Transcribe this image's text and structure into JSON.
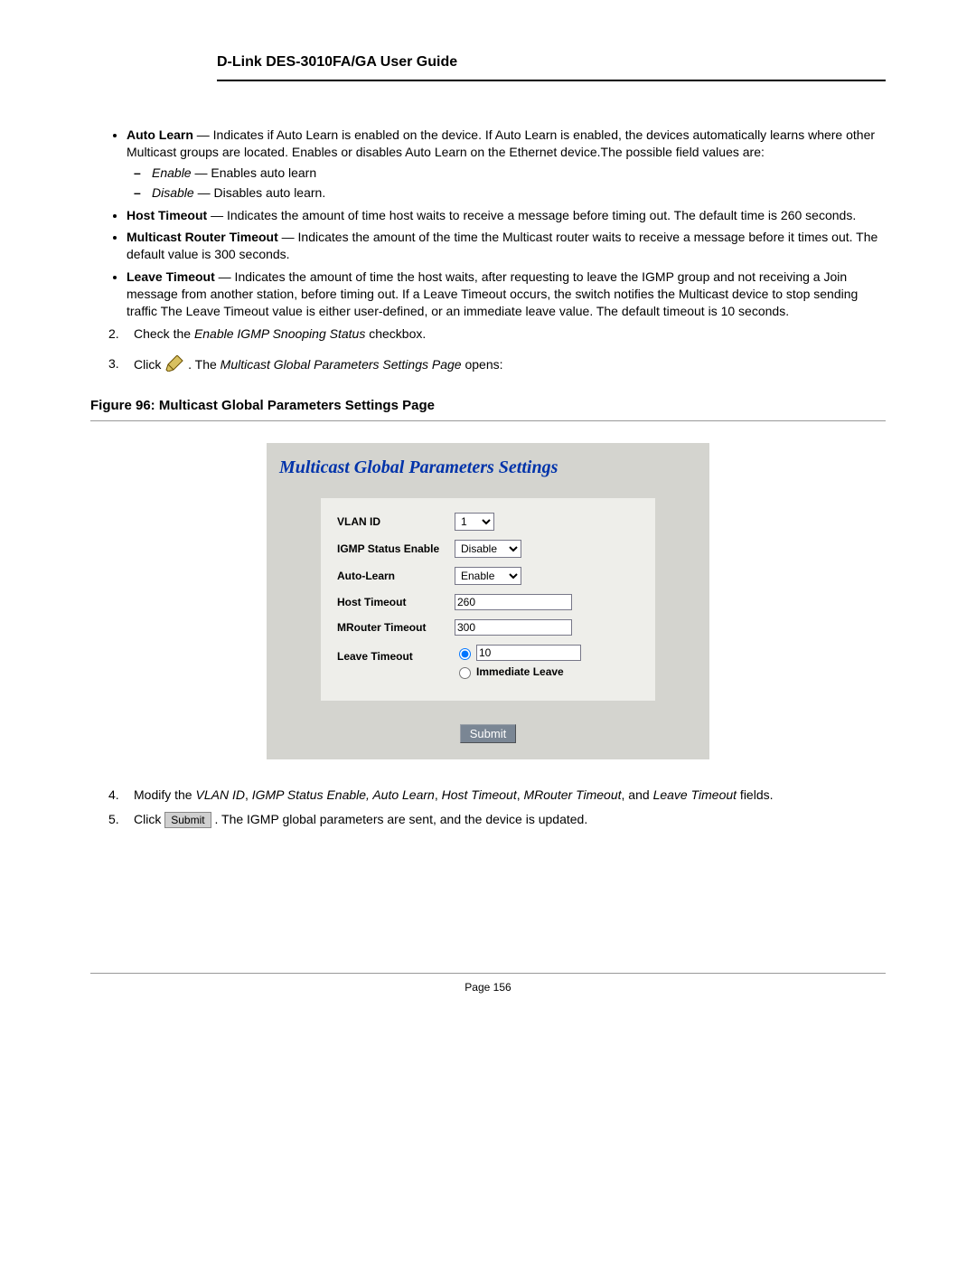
{
  "header": "D-Link DES-3010FA/GA User Guide",
  "bullets": {
    "autoLearn": {
      "term": "Auto Learn",
      "desc": " — Indicates if Auto Learn is enabled on the device. If Auto Learn is enabled, the devices automatically learns where other Multicast groups are located. Enables or disables Auto Learn on the Ethernet device.The possible field values are:",
      "enableTerm": "Enable",
      "enableDesc": " — Enables auto learn",
      "disableTerm": "Disable",
      "disableDesc": " — Disables auto learn."
    },
    "hostTimeout": {
      "term": "Host Timeout",
      "desc": " — Indicates the amount of time host waits to receive a message before timing out. The default time is 260 seconds."
    },
    "mrouter": {
      "term": "Multicast Router Timeout",
      "desc": " — Indicates the amount of the time the Multicast router waits to receive a message before it times out. The default value is 300 seconds."
    },
    "leave": {
      "term": "Leave Timeout",
      "desc": " — Indicates the amount of time the host waits, after requesting to leave the IGMP group and not receiving a Join message from another station, before timing out. If a Leave Timeout occurs, the switch notifies the Multicast device to stop sending traffic The Leave Timeout value is either user-defined, or an immediate leave value. The default timeout is 10 seconds."
    }
  },
  "steps": {
    "s2num": "2.",
    "s2a": "Check the ",
    "s2b": "Enable IGMP Snooping Status",
    "s2c": " checkbox.",
    "s3num": "3.",
    "s3a": "Click ",
    "s3b": " . The ",
    "s3c": "Multicast Global Parameters Settings Page",
    "s3d": " opens:",
    "s4num": "4.",
    "s4a": "Modify the ",
    "s4b": "VLAN ID",
    "s4c": ", ",
    "s4d": "IGMP Status Enable, Auto Learn",
    "s4e": ", ",
    "s4f": "Host Timeout",
    "s4g": ", ",
    "s4h": "MRouter Timeout",
    "s4i": ", and ",
    "s4j": "Leave Timeout",
    "s4k": " fields.",
    "s5num": "5.",
    "s5a": "Click ",
    "s5btn": "Submit",
    "s5b": ". The IGMP global parameters are sent, and the device is updated."
  },
  "figureCaption": "Figure 96:  Multicast Global Parameters Settings Page",
  "panel": {
    "title": "Multicast Global Parameters Settings",
    "labels": {
      "vlan": "VLAN ID",
      "igmp": "IGMP Status Enable",
      "auto": "Auto-Learn",
      "host": "Host Timeout",
      "mrouter": "MRouter Timeout",
      "leave": "Leave Timeout",
      "immediate": "Immediate Leave"
    },
    "values": {
      "vlan": "1",
      "igmp": "Disable",
      "auto": "Enable",
      "host": "260",
      "mrouter": "300",
      "leave": "10"
    },
    "submit": "Submit"
  },
  "footer": "Page 156"
}
